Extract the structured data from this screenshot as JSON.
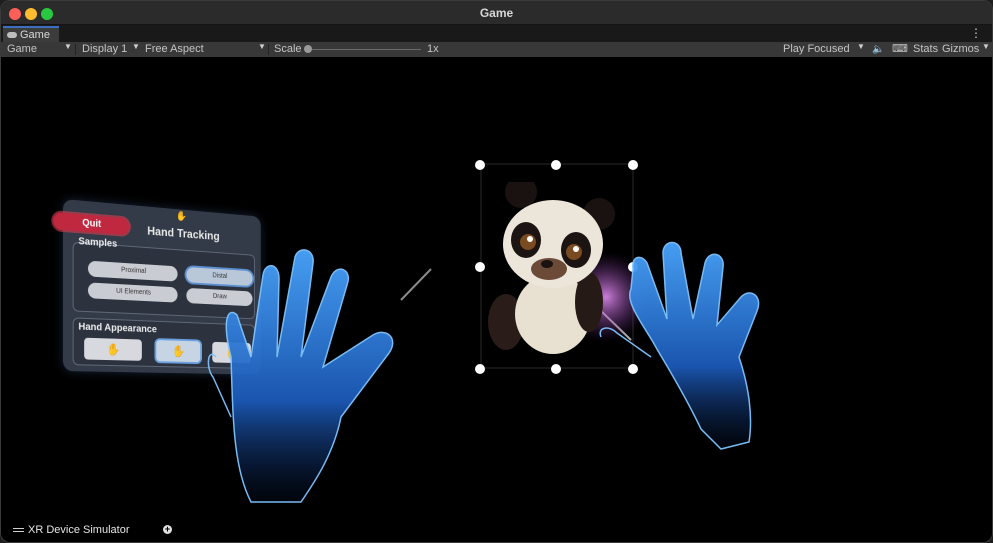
{
  "window": {
    "title": "Game"
  },
  "tab": {
    "label": "Game",
    "icon": "gamepad-icon"
  },
  "toolbar": {
    "view_dropdown": "Game",
    "display_dropdown": "Display 1",
    "aspect_dropdown": "Free Aspect",
    "scale_label": "Scale",
    "scale_value": "1x",
    "play_mode_dropdown": "Play Focused",
    "stats_label": "Stats",
    "gizmos_label": "Gizmos",
    "mute_icon": "speaker-icon",
    "keyboard_icon": "keyboard-icon"
  },
  "panel": {
    "quit_label": "Quit",
    "title": "Hand Tracking",
    "samples_label": "Samples",
    "samples": [
      "Proximal",
      "Distal",
      "UI Elements",
      "Draw"
    ],
    "hand_appearance_label": "Hand Appearance"
  },
  "simulator": {
    "label": "XR Device Simulator"
  },
  "colors": {
    "accent": "#3c6fbf",
    "quit": "#c0283f",
    "hand_glow": "#2f8cff"
  }
}
